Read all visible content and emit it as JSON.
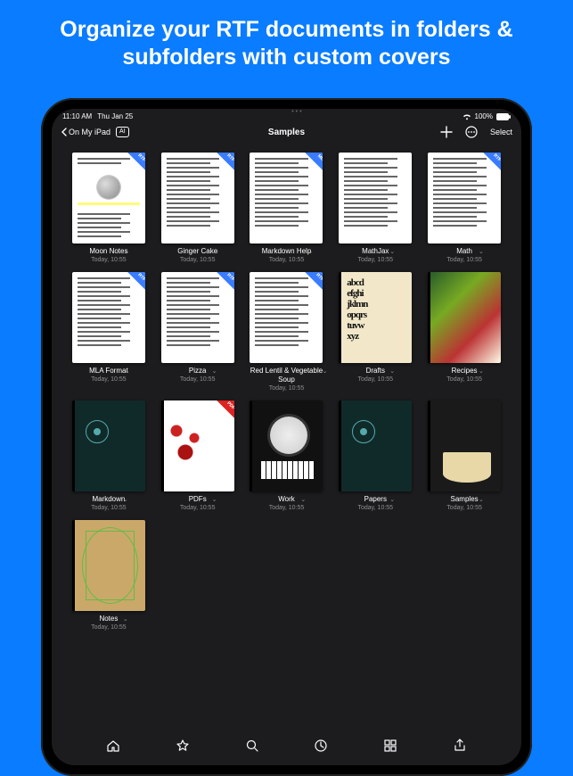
{
  "headline": "Organize your RTF documents in folders & subfolders with custom covers",
  "status": {
    "time": "11:10 AM",
    "date": "Thu Jan 25",
    "battery": "100%"
  },
  "nav": {
    "back_label": "On My iPad",
    "ai_label": "AI",
    "title": "Samples",
    "select_label": "Select"
  },
  "items": [
    {
      "name": "Moon Notes",
      "date": "Today, 10:55",
      "badge": "RTF",
      "cover": "moon"
    },
    {
      "name": "Ginger Cake",
      "date": "Today, 10:55",
      "badge": "RTF",
      "cover": "doc"
    },
    {
      "name": "Markdown Help",
      "date": "Today, 10:55",
      "badge": "MD",
      "cover": "doc"
    },
    {
      "name": "MathJax",
      "date": "Today, 10:55",
      "badge": "",
      "cover": "doc"
    },
    {
      "name": "Math",
      "date": "Today, 10:55",
      "badge": "RTF",
      "cover": "doc"
    },
    {
      "name": "MLA Format",
      "date": "Today, 10:55",
      "badge": "RTF",
      "cover": "doc"
    },
    {
      "name": "Pizza",
      "date": "Today, 10:55",
      "badge": "RTF",
      "cover": "doc"
    },
    {
      "name": "Red Lentil & Vegetable Soup",
      "date": "Today, 10:55",
      "badge": "RTF",
      "cover": "doc"
    },
    {
      "name": "Drafts",
      "date": "Today, 10:55",
      "badge": "",
      "cover": "alpha",
      "folder": true
    },
    {
      "name": "Recipes",
      "date": "Today, 10:55",
      "badge": "",
      "cover": "food",
      "folder": true
    },
    {
      "name": "Markdown",
      "date": "Today, 10:55",
      "badge": "",
      "cover": "dark",
      "folder": true
    },
    {
      "name": "PDFs",
      "date": "Today, 10:55",
      "badge": "PDF",
      "cover": "red",
      "folder": true
    },
    {
      "name": "Work",
      "date": "Today, 10:55",
      "badge": "",
      "cover": "clock",
      "folder": true
    },
    {
      "name": "Papers",
      "date": "Today, 10:55",
      "badge": "",
      "cover": "dark",
      "folder": true
    },
    {
      "name": "Samples",
      "date": "Today, 10:55",
      "badge": "",
      "cover": "math",
      "folder": true
    },
    {
      "name": "Notes",
      "date": "Today, 10:55",
      "badge": "",
      "cover": "vitruvian",
      "folder": true
    }
  ],
  "bottom_icons": [
    "home",
    "favorites",
    "search",
    "recent",
    "browse",
    "share"
  ]
}
